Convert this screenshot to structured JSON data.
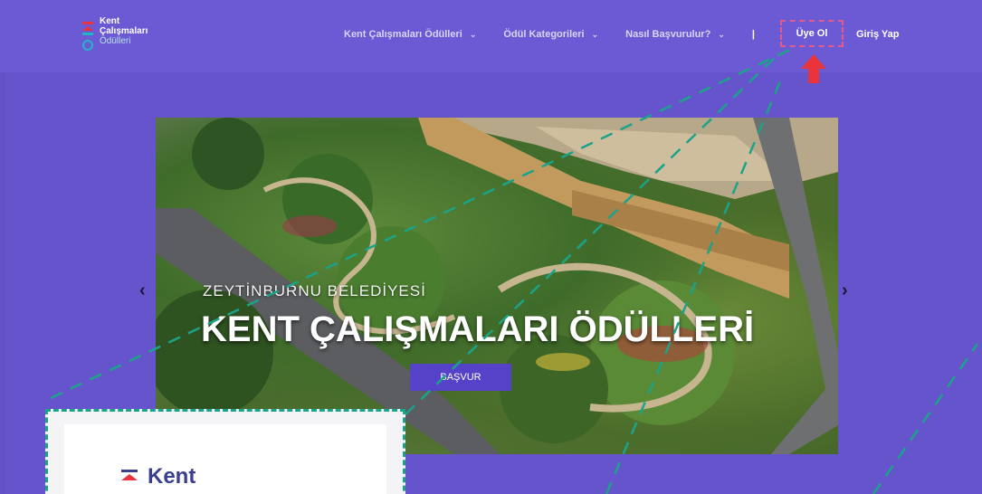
{
  "logo": {
    "line1": "Kent",
    "line2": "Çalışmaları",
    "line3": "Ödülleri"
  },
  "nav": {
    "items": [
      {
        "label": "Kent Çalışmaları Ödülleri",
        "has_dropdown": true
      },
      {
        "label": "Ödül Kategorileri",
        "has_dropdown": true
      },
      {
        "label": "Nasıl Başvurulur?",
        "has_dropdown": true
      }
    ],
    "separator": "|",
    "signup": "Üye Ol",
    "login": "Giriş Yap"
  },
  "hero": {
    "subtitle": "ZEYTİNBURNU BELEDİYESİ",
    "title": "KENT ÇALIŞMALARI ÖDÜLLERİ",
    "button": "BAŞVUR"
  },
  "carousel": {
    "prev_icon": "chevron-left-icon",
    "next_icon": "chevron-right-icon",
    "prev_glyph": "‹",
    "next_glyph": "›"
  },
  "zoom_preview": {
    "logo_text": "Kent"
  },
  "colors": {
    "page_bg": "#6654cc",
    "navbar_bg": "#6b5ad4",
    "button_bg": "#5642c8",
    "highlight_dash": "#e05a8a",
    "arrow": "#e8343a",
    "zoom_dash": "#1ba38a"
  }
}
